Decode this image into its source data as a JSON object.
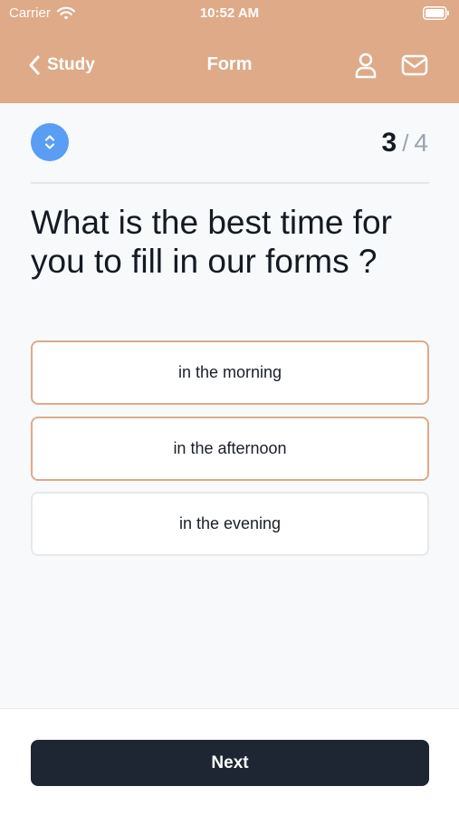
{
  "status_bar": {
    "carrier": "Carrier",
    "time": "10:52 AM"
  },
  "nav": {
    "back_label": "Study",
    "title": "Form",
    "icons": [
      "user-icon",
      "mail-icon"
    ]
  },
  "progress": {
    "current": "3",
    "separator": "/",
    "total": "4"
  },
  "question": "What is the best time for you to fill in our forms ?",
  "options": [
    {
      "label": "in the morning"
    },
    {
      "label": "in the afternoon"
    },
    {
      "label": "in the evening"
    }
  ],
  "footer": {
    "next_label": "Next"
  },
  "colors": {
    "header": "#deaa88",
    "accent_blue": "#5a9df5",
    "option_highlight_border": "#deaa88",
    "next_button": "#1e2633",
    "background": "#f7f9fb"
  }
}
